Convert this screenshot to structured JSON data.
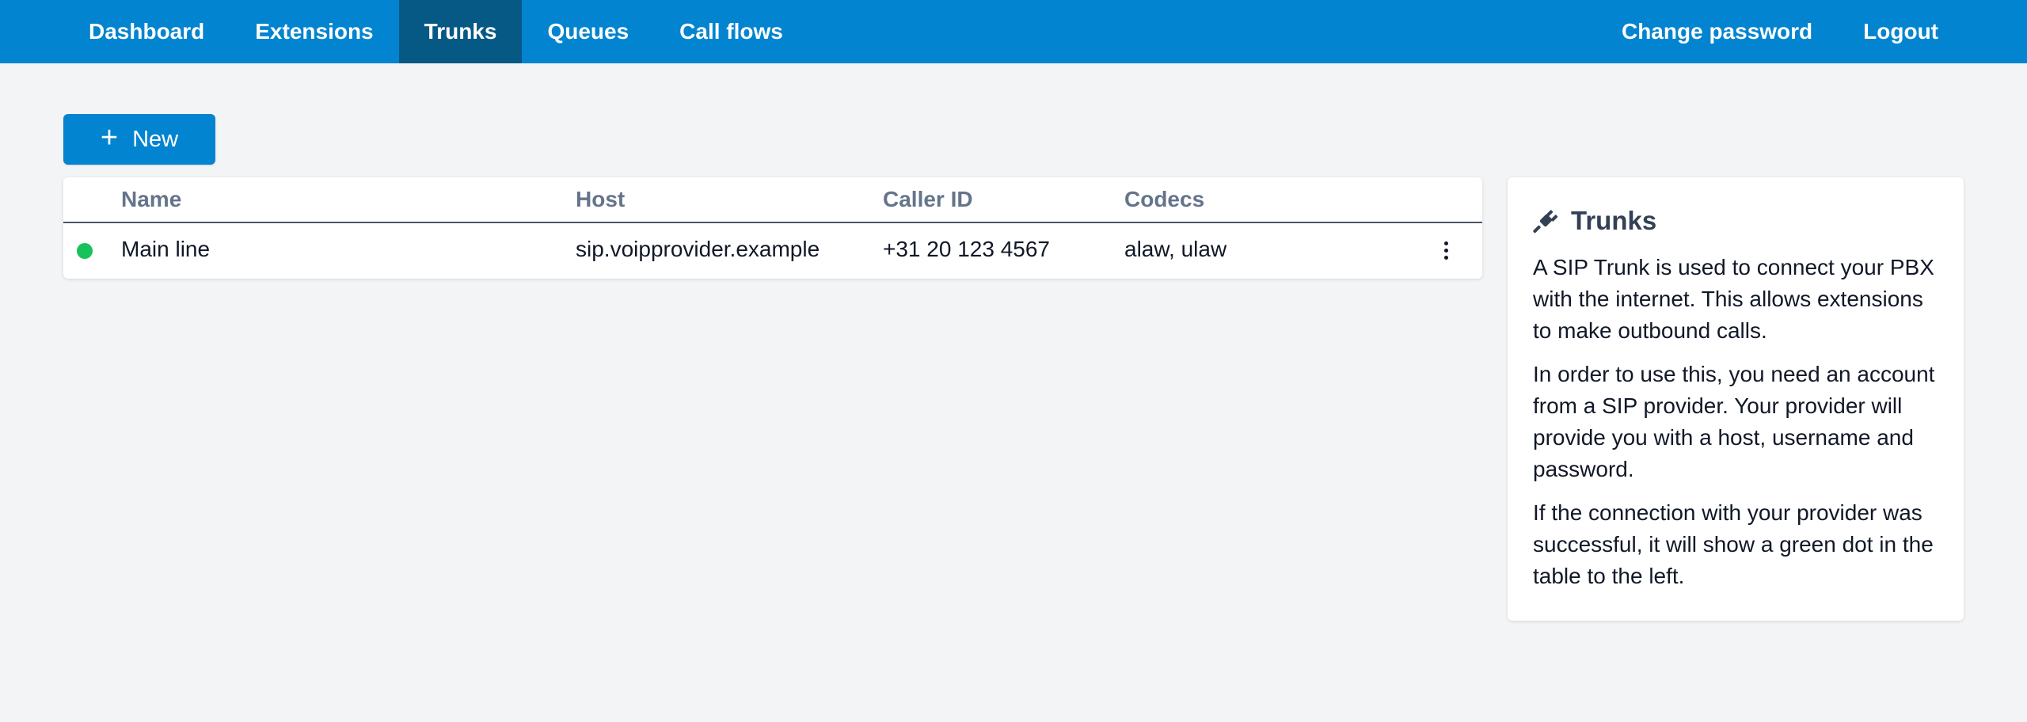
{
  "nav": {
    "left": [
      "Dashboard",
      "Extensions",
      "Trunks",
      "Queues",
      "Call flows"
    ],
    "active": "Trunks",
    "right": [
      "Change password",
      "Logout"
    ]
  },
  "actions": {
    "new_label": "New"
  },
  "table": {
    "headers": {
      "name": "Name",
      "host": "Host",
      "caller_id": "Caller ID",
      "codecs": "Codecs"
    },
    "rows": [
      {
        "status": "connected",
        "name": "Main line",
        "host": "sip.voipprovider.example",
        "caller_id": "+31 20 123 4567",
        "codecs": "alaw, ulaw"
      }
    ]
  },
  "info": {
    "icon": "plug-icon",
    "title": "Trunks",
    "paragraphs": [
      "A SIP Trunk is used to connect your PBX with the internet. This allows extensions to make outbound calls.",
      "In order to use this, you need an account from a SIP provider. Your provider will provide you with a host, username and password.",
      "If the connection with your provider was successful, it will show a green dot in the table to the left."
    ]
  },
  "colors": {
    "primary": "#0284d0",
    "nav_active": "#075985",
    "background": "#f3f4f6",
    "status_connected": "#16c35a",
    "header_text": "#64748b"
  }
}
